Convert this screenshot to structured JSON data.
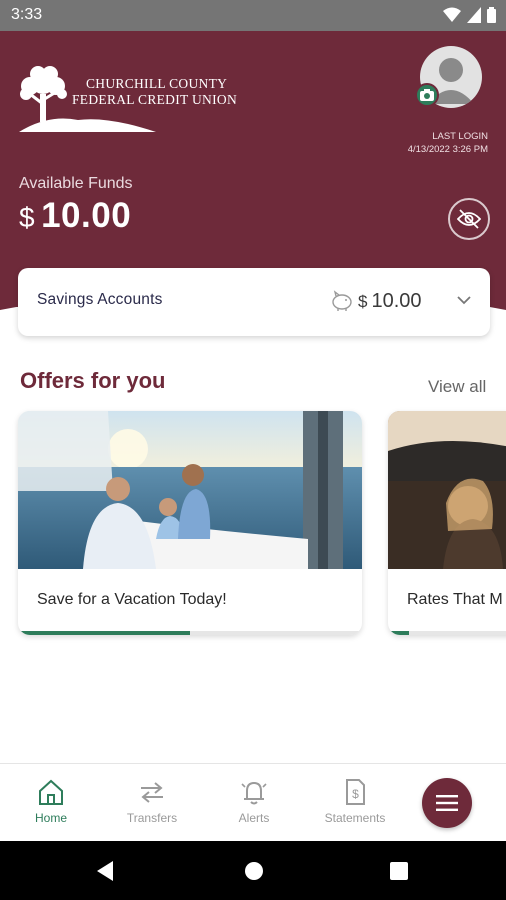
{
  "status_bar": {
    "time": "3:33"
  },
  "header": {
    "logo_line1": "CHURCHILL COUNTY",
    "logo_line2": "FEDERAL CREDIT UNION",
    "last_login_label": "LAST LOGIN",
    "last_login_value": "4/13/2022 3:26 PM",
    "available_label": "Available Funds",
    "currency": "$",
    "available_amount": "10.00"
  },
  "account": {
    "name": "Savings Accounts",
    "currency": "$",
    "amount": "10.00"
  },
  "offers": {
    "title": "Offers for you",
    "view_all": "View all",
    "items": [
      {
        "label": "Save for a Vacation Today!",
        "progress": 0.5
      },
      {
        "label": "Rates That M",
        "progress": 0.15
      }
    ]
  },
  "bottom_nav": {
    "items": [
      {
        "label": "Home",
        "icon": "home-icon",
        "active": true
      },
      {
        "label": "Transfers",
        "icon": "transfers-icon",
        "active": false
      },
      {
        "label": "Alerts",
        "icon": "bell-icon",
        "active": false
      },
      {
        "label": "Statements",
        "icon": "statement-icon",
        "active": false
      }
    ],
    "menu_icon": "hamburger-icon"
  },
  "colors": {
    "brand": "#6e2a3a",
    "accent": "#2e7d5b"
  }
}
